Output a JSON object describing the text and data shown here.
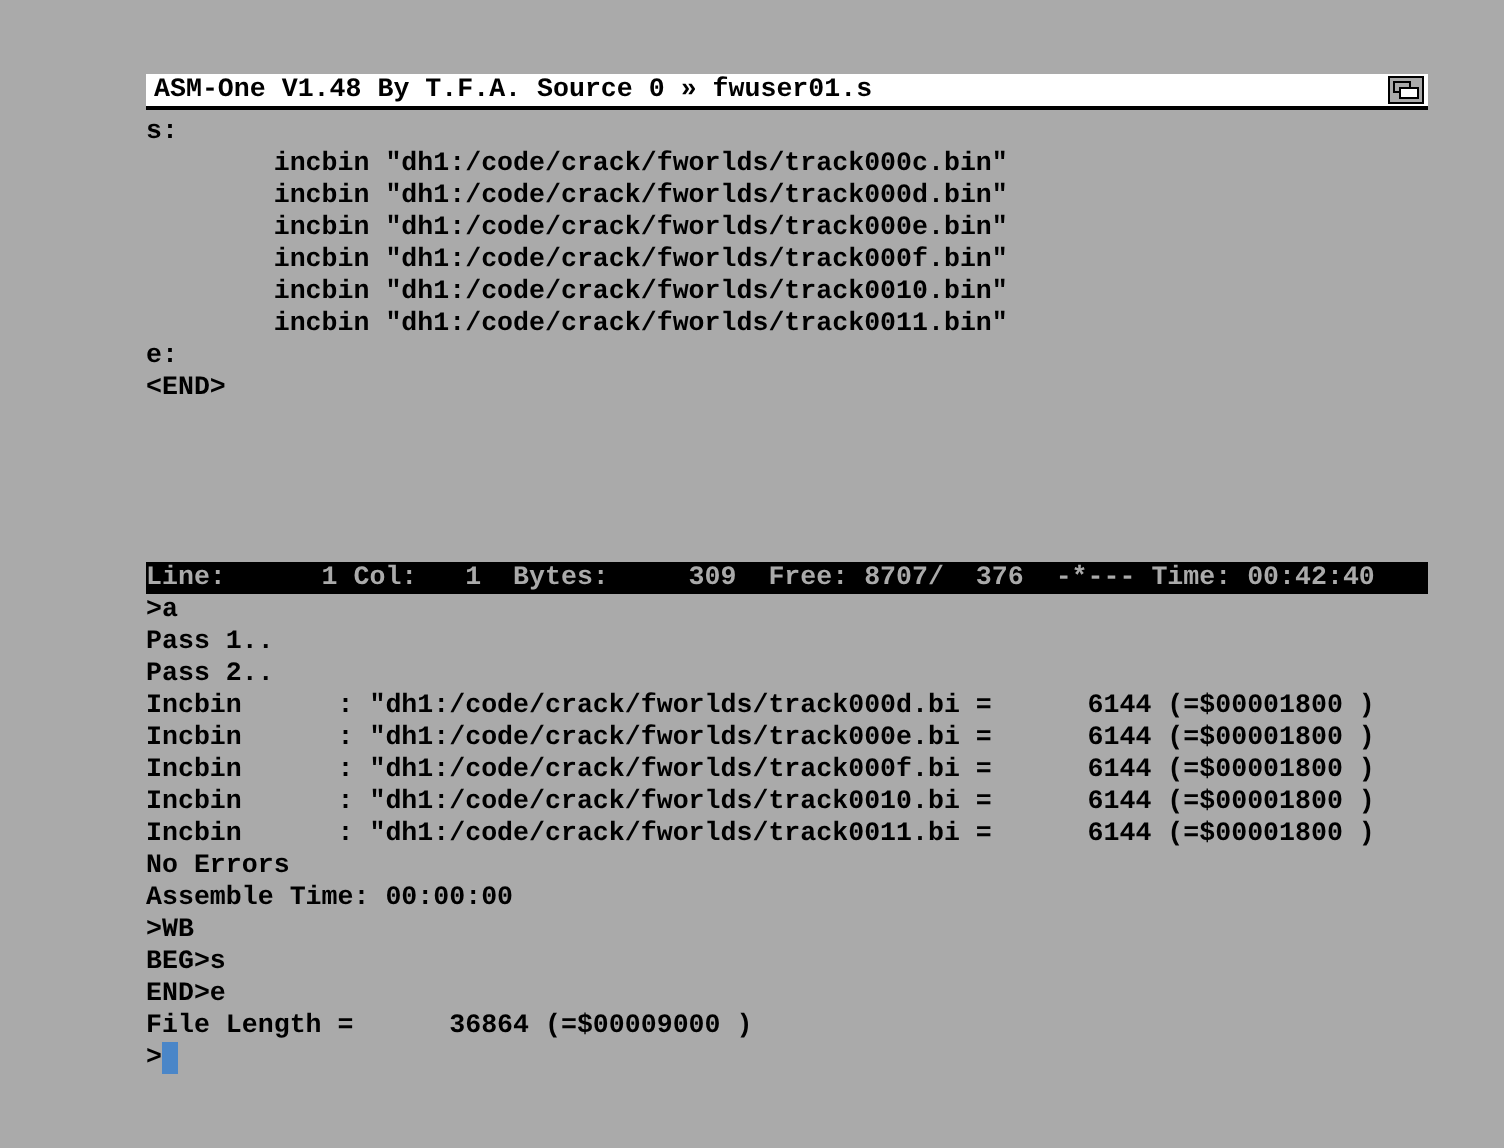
{
  "window": {
    "title": "ASM-One V1.48 By T.F.A. Source 0 » fwuser01.s"
  },
  "editor": {
    "lines": [
      "s:",
      "        incbin \"dh1:/code/crack/fworlds/track000c.bin\"",
      "        incbin \"dh1:/code/crack/fworlds/track000d.bin\"",
      "        incbin \"dh1:/code/crack/fworlds/track000e.bin\"",
      "        incbin \"dh1:/code/crack/fworlds/track000f.bin\"",
      "        incbin \"dh1:/code/crack/fworlds/track0010.bin\"",
      "        incbin \"dh1:/code/crack/fworlds/track0011.bin\"",
      "e:",
      "<END>"
    ]
  },
  "status_bar": "Line:      1 Col:   1  Bytes:     309  Free: 8707/  376  -*--- Time: 00:42:40",
  "console": {
    "lines": [
      ">a",
      "Pass 1..",
      "Pass 2..",
      "Incbin      : \"dh1:/code/crack/fworlds/track000d.bi =      6144 (=$00001800 )",
      "Incbin      : \"dh1:/code/crack/fworlds/track000e.bi =      6144 (=$00001800 )",
      "Incbin      : \"dh1:/code/crack/fworlds/track000f.bi =      6144 (=$00001800 )",
      "Incbin      : \"dh1:/code/crack/fworlds/track0010.bi =      6144 (=$00001800 )",
      "Incbin      : \"dh1:/code/crack/fworlds/track0011.bi =      6144 (=$00001800 )",
      "No Errors",
      "Assemble Time: 00:00:00",
      ">WB",
      "BEG>s",
      "END>e",
      "File Length =      36864 (=$00009000 )"
    ],
    "prompt": ">"
  }
}
